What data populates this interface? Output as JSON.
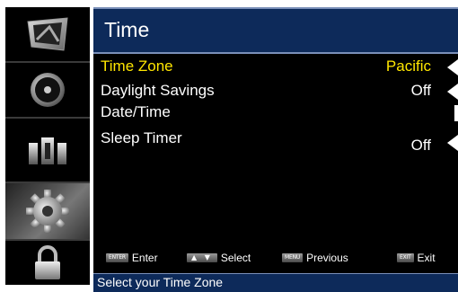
{
  "sidebar": {
    "items": [
      {
        "icon": "picture-icon"
      },
      {
        "icon": "audio-icon"
      },
      {
        "icon": "tv-antenna-icon"
      },
      {
        "icon": "setup-gear-icon",
        "active": true
      },
      {
        "icon": "lock-icon"
      }
    ]
  },
  "header": {
    "title": "Time"
  },
  "menu": {
    "items": [
      {
        "label": "Time Zone",
        "value": "Pacific"
      },
      {
        "label": "Daylight Savings",
        "value": "Off"
      },
      {
        "label": "Date/Time",
        "value": ""
      },
      {
        "label": "Sleep Timer",
        "value": "Off"
      }
    ]
  },
  "legend": {
    "enter_key": "ENTER",
    "enter_label": "Enter",
    "select_key": "▲ ▼",
    "select_label": "Select",
    "menu_key": "MENU",
    "menu_label": "Previous",
    "exit_key": "EXIT",
    "exit_label": "Exit"
  },
  "help": {
    "text": "Select your Time Zone"
  },
  "colors": {
    "selected_text": "#ffe600",
    "title_bar": "#0d2a5a",
    "background": "#000000"
  }
}
